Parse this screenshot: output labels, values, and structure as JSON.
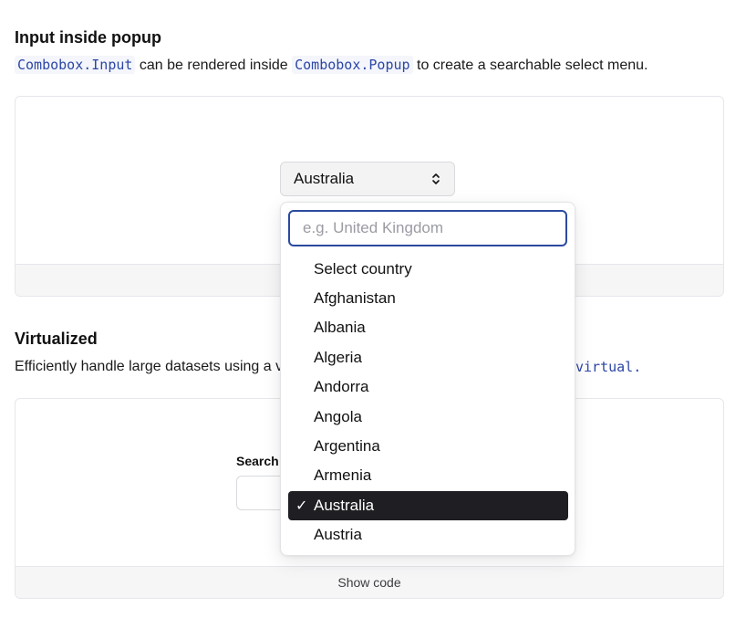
{
  "section1": {
    "heading": "Input inside popup",
    "code1": "Combobox.Input",
    "text1": " can be rendered inside ",
    "code2": "Combobox.Popup",
    "text2": " to create a searchable select menu."
  },
  "section2": {
    "heading": "Virtualized",
    "text_visible": "Efficiently handle large datasets using a v",
    "code_visible": "virtual."
  },
  "trigger": {
    "value": "Australia",
    "icon": "chevrons-up-down-icon"
  },
  "popup": {
    "placeholder": "e.g. United Kingdom",
    "options": [
      "Select country",
      "Afghanistan",
      "Albania",
      "Algeria",
      "Andorra",
      "Angola",
      "Argentina",
      "Armenia",
      "Australia",
      "Austria"
    ],
    "selected_index": 8,
    "check_glyph": "✓"
  },
  "virtualized_demo": {
    "label_visible": "Search"
  },
  "footer": {
    "show_code": "Show code"
  },
  "colors": {
    "accent": "#2b4aa0",
    "selected_bg": "#1f1f23",
    "code_text": "#2c46a6"
  }
}
